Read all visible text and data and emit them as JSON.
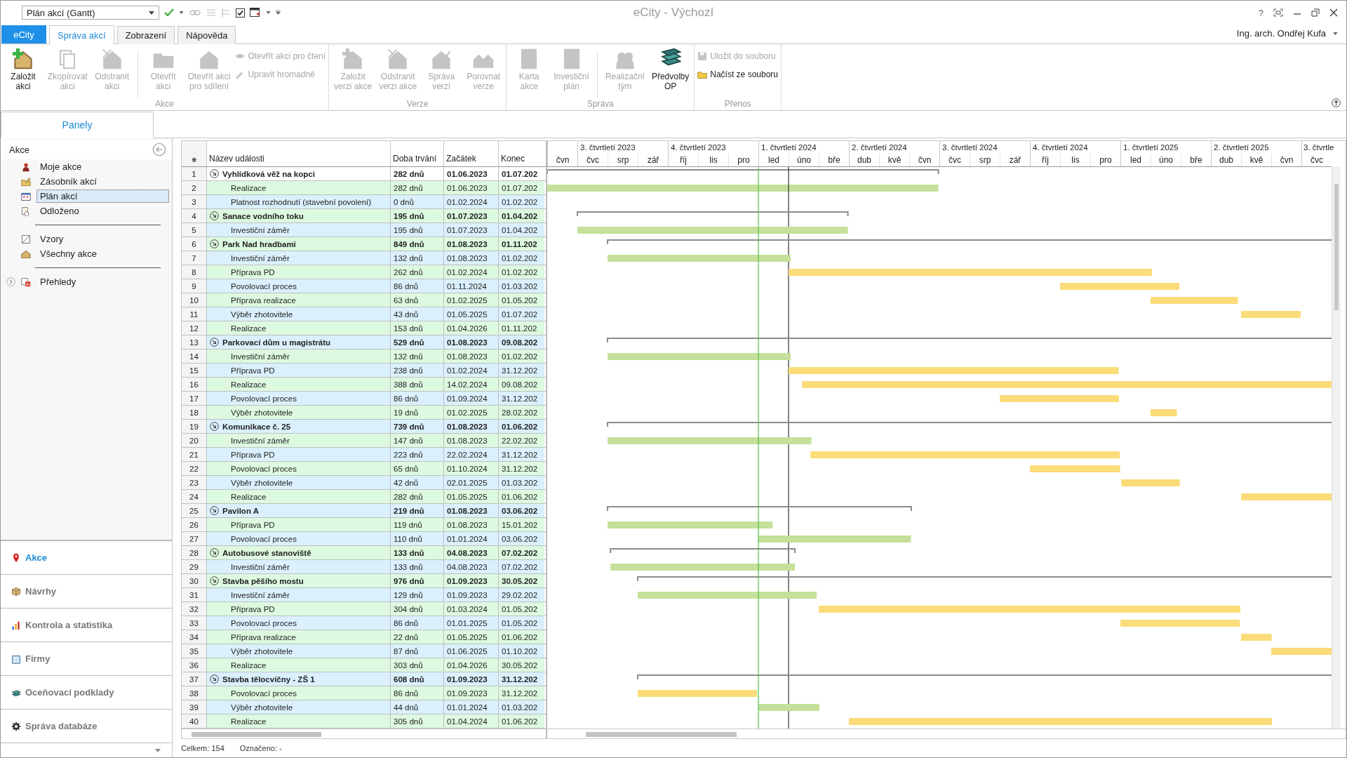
{
  "window": {
    "view": "Plán akcí (Gantt)",
    "title": "eCity - Výchozí",
    "help": "?",
    "user": "Ing. arch. Ondřej Kufa"
  },
  "app_tab": "eCity",
  "tabs": [
    {
      "label": "Správa akcí",
      "selected": true
    },
    {
      "label": "Zobrazení",
      "selected": false
    },
    {
      "label": "Nápověda",
      "selected": false
    }
  ],
  "ribbon": {
    "groups": [
      {
        "label": "Akce",
        "items": [
          {
            "kind": "large",
            "label": "Založit\nakci",
            "disabled": false
          },
          {
            "kind": "large",
            "label": "Zkopírovat\nakci",
            "disabled": true
          },
          {
            "kind": "large",
            "label": "Odstranit\nakci",
            "disabled": true
          },
          {
            "kind": "separator"
          },
          {
            "kind": "large",
            "label": "Otevřít\nakci",
            "disabled": true
          },
          {
            "kind": "large",
            "label": "Otevřít akci\npro sdílení",
            "disabled": true
          },
          {
            "kind": "stack",
            "buttons": [
              {
                "label": "Otevřít akci pro čtení",
                "disabled": true
              },
              {
                "label": "Upravit hromadně",
                "disabled": true
              }
            ]
          }
        ]
      },
      {
        "label": "Verze",
        "items": [
          {
            "kind": "large",
            "label": "Založit\nverzi akce",
            "disabled": true
          },
          {
            "kind": "large",
            "label": "Odstranit\nverzi akce",
            "disabled": true
          },
          {
            "kind": "large",
            "label": "Správa\nverzí",
            "disabled": true
          },
          {
            "kind": "large",
            "label": "Porovnat\nverze",
            "disabled": true
          }
        ]
      },
      {
        "label": "Správa",
        "items": [
          {
            "kind": "large",
            "label": "Karta\nakce",
            "disabled": true
          },
          {
            "kind": "large",
            "label": "Investiční\nplán",
            "disabled": true
          },
          {
            "kind": "separator"
          },
          {
            "kind": "large",
            "label": "Realizační\ntým",
            "disabled": true
          },
          {
            "kind": "large",
            "label": "Předvolby\nOP",
            "disabled": false
          }
        ]
      },
      {
        "label": "Přenos",
        "items": [
          {
            "kind": "stack",
            "buttons": [
              {
                "label": "Uložit do souboru",
                "disabled": true
              },
              {
                "label": "Načíst ze souboru",
                "disabled": false
              }
            ]
          }
        ]
      }
    ]
  },
  "panel_tab": "Panely",
  "sidebar": {
    "title": "Akce",
    "items": [
      {
        "kind": "item",
        "label": "Moje akce",
        "selected": false
      },
      {
        "kind": "item",
        "label": "Zásobník akcí",
        "selected": false
      },
      {
        "kind": "item",
        "label": "Plán akcí",
        "selected": true
      },
      {
        "kind": "item",
        "label": "Odloženo",
        "selected": false
      },
      {
        "kind": "divider"
      },
      {
        "kind": "item",
        "label": "Vzory",
        "selected": false
      },
      {
        "kind": "item",
        "label": "Všechny akce",
        "selected": false
      },
      {
        "kind": "divider"
      },
      {
        "kind": "expandable",
        "label": "Přehledy",
        "selected": false,
        "expanded": false
      }
    ],
    "nav": [
      {
        "label": "Akce",
        "selected": true
      },
      {
        "label": "Návrhy",
        "selected": false
      },
      {
        "label": "Kontrola a statistika",
        "selected": false
      },
      {
        "label": "Firmy",
        "selected": false
      },
      {
        "label": "Oceňovací podklady",
        "selected": false
      },
      {
        "label": "Správa databáze",
        "selected": false
      }
    ]
  },
  "table": {
    "columns": [
      "❋",
      "Název události",
      "Doba trvání",
      "Začátek",
      "Konec"
    ],
    "rows": [
      {
        "no": "1",
        "kind": "group",
        "name": "Vyhlídková věž na kopci",
        "duration": "282 dnů",
        "start": "01.06.2023",
        "end": "01.07.202",
        "selected": true,
        "children": [
          {
            "no": "2",
            "kind": "task",
            "name": "Realizace",
            "duration": "282 dnů",
            "start": "01.06.2023",
            "end": "01.07.202",
            "selected": false,
            "color": "#c5e09a"
          },
          {
            "no": "3",
            "kind": "milestone",
            "name": "Platnost rozhodnutí (stavební povolení)",
            "duration": "0 dnů",
            "start": "01.02.2024",
            "end": "01.02.202",
            "selected": false
          }
        ]
      },
      {
        "no": "4",
        "kind": "group",
        "name": "Sanace vodního toku",
        "duration": "195 dnů",
        "start": "01.07.2023",
        "end": "01.04.202",
        "selected": false,
        "children": [
          {
            "no": "5",
            "kind": "task",
            "name": "Investiční záměr",
            "duration": "195 dnů",
            "start": "01.07.2023",
            "end": "01.04.202",
            "selected": false,
            "color": "#c5e09a"
          }
        ]
      },
      {
        "no": "6",
        "kind": "group",
        "name": "Park Nad hradbami",
        "duration": "849 dnů",
        "start": "01.08.2023",
        "end": "01.11.202",
        "selected": false,
        "children": [
          {
            "no": "7",
            "kind": "task",
            "name": "Investiční záměr",
            "duration": "132 dnů",
            "start": "01.08.2023",
            "end": "01.02.202",
            "selected": false,
            "color": "#c5e09a"
          },
          {
            "no": "8",
            "kind": "task",
            "name": "Příprava PD",
            "duration": "262 dnů",
            "start": "01.02.2024",
            "end": "01.02.202",
            "selected": false,
            "color": "#fbdc78"
          },
          {
            "no": "9",
            "kind": "task",
            "name": "Povolovací proces",
            "duration": "86 dnů",
            "start": "01.11.2024",
            "end": "01.03.202",
            "selected": false,
            "color": "#fbdc78"
          },
          {
            "no": "10",
            "kind": "task",
            "name": "Příprava realizace",
            "duration": "63 dnů",
            "start": "01.02.2025",
            "end": "01.05.202",
            "selected": false,
            "color": "#fbdc78"
          },
          {
            "no": "11",
            "kind": "task",
            "name": "Výběr zhotovitele",
            "duration": "43 dnů",
            "start": "01.05.2025",
            "end": "01.07.202",
            "selected": false,
            "color": "#fbdc78"
          },
          {
            "no": "12",
            "kind": "task",
            "name": "Realizace",
            "duration": "153 dnů",
            "start": "01.04.2026",
            "end": "01.11.202",
            "selected": false
          }
        ]
      },
      {
        "no": "13",
        "kind": "group",
        "name": "Parkovací dům u magistrátu",
        "duration": "529 dnů",
        "start": "01.08.2023",
        "end": "09.08.202",
        "selected": false,
        "children": [
          {
            "no": "14",
            "kind": "task",
            "name": "Investiční záměr",
            "duration": "132 dnů",
            "start": "01.08.2023",
            "end": "01.02.202",
            "selected": false,
            "color": "#c5e09a"
          },
          {
            "no": "15",
            "kind": "task",
            "name": "Příprava PD",
            "duration": "238 dnů",
            "start": "01.02.2024",
            "end": "31.12.202",
            "selected": false,
            "color": "#fbdc78"
          },
          {
            "no": "16",
            "kind": "task",
            "name": "Realizace",
            "duration": "388 dnů",
            "start": "14.02.2024",
            "end": "09.08.202",
            "selected": false,
            "color": "#fbdc78"
          },
          {
            "no": "17",
            "kind": "task",
            "name": "Povolovací proces",
            "duration": "86 dnů",
            "start": "01.09.2024",
            "end": "31.12.202",
            "selected": false,
            "color": "#fbdc78"
          },
          {
            "no": "18",
            "kind": "task",
            "name": "Výběr zhotovitele",
            "duration": "19 dnů",
            "start": "01.02.2025",
            "end": "28.02.202",
            "selected": false,
            "color": "#fbdc78"
          }
        ]
      },
      {
        "no": "19",
        "kind": "group",
        "name": "Komunikace č. 25",
        "duration": "739 dnů",
        "start": "01.08.2023",
        "end": "01.06.202",
        "selected": false,
        "children": [
          {
            "no": "20",
            "kind": "task",
            "name": "Investiční záměr",
            "duration": "147 dnů",
            "start": "01.08.2023",
            "end": "22.02.202",
            "selected": false,
            "color": "#c5e09a"
          },
          {
            "no": "21",
            "kind": "task",
            "name": "Příprava PD",
            "duration": "223 dnů",
            "start": "22.02.2024",
            "end": "31.12.202",
            "selected": false,
            "color": "#fbdc78"
          },
          {
            "no": "22",
            "kind": "task",
            "name": "Povolovací proces",
            "duration": "65 dnů",
            "start": "01.10.2024",
            "end": "31.12.202",
            "selected": false,
            "color": "#fbdc78"
          },
          {
            "no": "23",
            "kind": "task",
            "name": "Výběr zhotovitele",
            "duration": "42 dnů",
            "start": "02.01.2025",
            "end": "01.03.202",
            "selected": false,
            "color": "#fbdc78"
          },
          {
            "no": "24",
            "kind": "task",
            "name": "Realizace",
            "duration": "282 dnů",
            "start": "01.05.2025",
            "end": "01.06.202",
            "selected": false,
            "color": "#fbdc78"
          }
        ]
      },
      {
        "no": "25",
        "kind": "group",
        "name": "Pavilon A",
        "duration": "219 dnů",
        "start": "01.08.2023",
        "end": "03.06.202",
        "selected": false,
        "children": [
          {
            "no": "26",
            "kind": "task",
            "name": "Příprava PD",
            "duration": "119 dnů",
            "start": "01.08.2023",
            "end": "15.01.202",
            "selected": false,
            "color": "#c5e09a"
          },
          {
            "no": "27",
            "kind": "task",
            "name": "Povolovací proces",
            "duration": "110 dnů",
            "start": "01.01.2024",
            "end": "03.06.202",
            "selected": false,
            "color": "#c5e09a"
          }
        ]
      },
      {
        "no": "28",
        "kind": "group",
        "name": "Autobusové stanoviště",
        "duration": "133 dnů",
        "start": "04.08.2023",
        "end": "07.02.202",
        "selected": false,
        "children": [
          {
            "no": "29",
            "kind": "task",
            "name": "Investiční záměr",
            "duration": "133 dnů",
            "start": "04.08.2023",
            "end": "07.02.202",
            "selected": false,
            "color": "#c5e09a"
          }
        ]
      },
      {
        "no": "30",
        "kind": "group",
        "name": "Stavba pěšího mostu",
        "duration": "976 dnů",
        "start": "01.09.2023",
        "end": "30.05.202",
        "selected": false,
        "children": [
          {
            "no": "31",
            "kind": "task",
            "name": "Investiční záměr",
            "duration": "129 dnů",
            "start": "01.09.2023",
            "end": "29.02.202",
            "selected": false,
            "color": "#c5e09a"
          },
          {
            "no": "32",
            "kind": "task",
            "name": "Příprava PD",
            "duration": "304 dnů",
            "start": "01.03.2024",
            "end": "01.05.202",
            "selected": false,
            "color": "#fbdc78"
          },
          {
            "no": "33",
            "kind": "task",
            "name": "Povolovací proces",
            "duration": "86 dnů",
            "start": "01.01.2025",
            "end": "01.05.202",
            "selected": false,
            "color": "#fbdc78"
          },
          {
            "no": "34",
            "kind": "task",
            "name": "Příprava realizace",
            "duration": "22 dnů",
            "start": "01.05.2025",
            "end": "01.06.202",
            "selected": false,
            "color": "#fbdc78"
          },
          {
            "no": "35",
            "kind": "task",
            "name": "Výběr zhotovitele",
            "duration": "87 dnů",
            "start": "01.06.2025",
            "end": "01.10.202",
            "selected": false,
            "color": "#fbdc78"
          },
          {
            "no": "36",
            "kind": "task",
            "name": "Realizace",
            "duration": "303 dnů",
            "start": "01.04.2026",
            "end": "30.05.202",
            "selected": false
          }
        ]
      },
      {
        "no": "37",
        "kind": "group",
        "name": "Stavba tělocvičny - ZŠ 1",
        "duration": "608 dnů",
        "start": "01.09.2023",
        "end": "31.12.202",
        "selected": false,
        "children": [
          {
            "no": "38",
            "kind": "task",
            "name": "Povolovací proces",
            "duration": "86 dnů",
            "start": "01.09.2023",
            "end": "31.12.202",
            "selected": false,
            "color": "#fbdc78"
          },
          {
            "no": "39",
            "kind": "task",
            "name": "Výběr zhotovitele",
            "duration": "44 dnů",
            "start": "01.01.2024",
            "end": "01.03.202",
            "selected": false,
            "color": "#c5e09a"
          },
          {
            "no": "40",
            "kind": "task",
            "name": "Realizace",
            "duration": "305 dnů",
            "start": "01.04.2024",
            "end": "01.06.202",
            "selected": false,
            "color": "#fbdc78"
          }
        ]
      }
    ]
  },
  "gantt": {
    "quarters": [
      {
        "months": [
          "čvn"
        ]
      },
      {
        "label": "3. čtvrtletí 2023",
        "months": [
          "čvc",
          "srp",
          "zář"
        ]
      },
      {
        "label": "4. čtvrtletí 2023",
        "months": [
          "říj",
          "lis",
          "pro"
        ]
      },
      {
        "label": "1. čtvrtletí 2024",
        "months": [
          "led",
          "úno",
          "bře"
        ]
      },
      {
        "label": "2. čtvrtletí 2024",
        "months": [
          "dub",
          "kvě",
          "čvn"
        ]
      },
      {
        "label": "3. čtvrtletí 2024",
        "months": [
          "čvc",
          "srp",
          "zář"
        ]
      },
      {
        "label": "4. čtvrtletí 2024",
        "months": [
          "říj",
          "lis",
          "pro"
        ]
      },
      {
        "label": "1. čtvrtletí 2025",
        "months": [
          "led",
          "úno",
          "bře"
        ]
      },
      {
        "label": "2. čtvrtletí 2025",
        "months": [
          "dub",
          "kvě",
          "čvn"
        ]
      },
      {
        "label": "3. čtvrtle",
        "months": [
          "čvc"
        ]
      }
    ]
  },
  "status_bar": {
    "total": "Celkem: 154",
    "marked": "Označeno: -"
  }
}
